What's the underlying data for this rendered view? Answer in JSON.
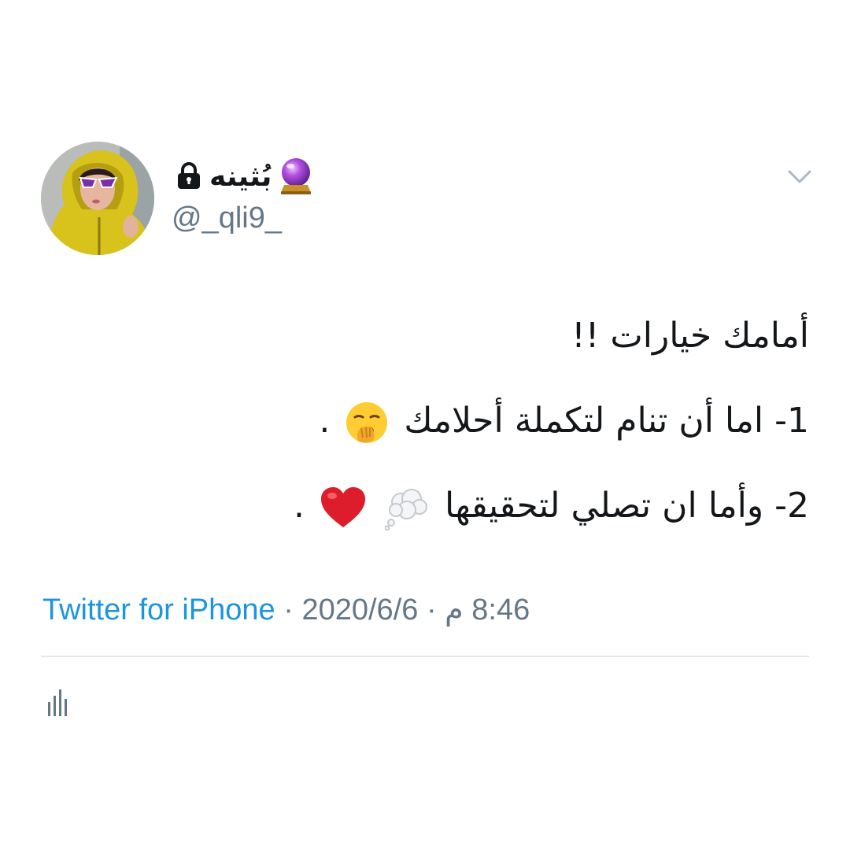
{
  "tweet": {
    "display_name": "بُثينه",
    "handle": "@_qli9_",
    "lines": [
      "أمامك خيارات !!",
      "1- اما أن تنام لتكملة أحلامك",
      "2- وأما ان تصلي لتحقيقها"
    ],
    "line_end": ".",
    "source": "Twitter for iPhone",
    "separator": " · ",
    "date": "2020/6/6",
    "time": "8:46 م"
  },
  "icons": {
    "lock": "lock-icon",
    "name_emoji": "crystal-ball-icon",
    "menu": "chevron-down-icon",
    "line2_emoji": "yawning-face-icon",
    "line3_emojis": [
      "thought-balloon-icon",
      "red-heart-icon"
    ],
    "analytics": "analytics-icon"
  },
  "colors": {
    "text": "#14171a",
    "secondary": "#657786",
    "link": "#1b95e0",
    "divider": "#e1e8ed"
  }
}
